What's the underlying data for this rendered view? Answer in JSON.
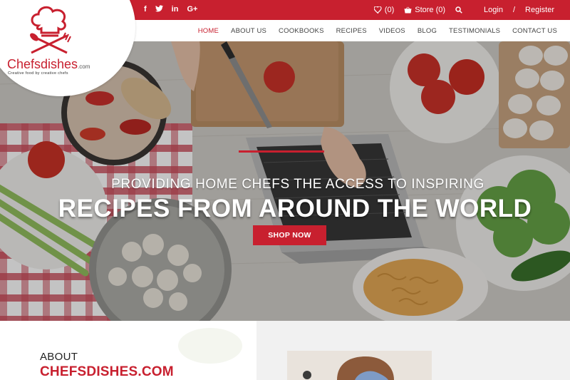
{
  "topbar": {
    "social": [
      {
        "icon": "facebook-icon",
        "glyph": "f"
      },
      {
        "icon": "twitter-icon",
        "glyph": "t"
      },
      {
        "icon": "linkedin-icon",
        "glyph": "in"
      },
      {
        "icon": "googleplus-icon",
        "glyph": "G+"
      }
    ],
    "wishlist_count": "(0)",
    "store_label": "Store (0)",
    "login": "Login",
    "separator": "/",
    "register": "Register"
  },
  "logo": {
    "name": "Chefsdishes",
    "suffix": ".com",
    "tagline": "Creative food by creative chefs"
  },
  "nav": {
    "items": [
      {
        "label": "HOME",
        "active": true
      },
      {
        "label": "ABOUT US",
        "active": false
      },
      {
        "label": "COOKBOOKS",
        "active": false
      },
      {
        "label": "RECIPES",
        "active": false
      },
      {
        "label": "VIDEOS",
        "active": false
      },
      {
        "label": "BLOG",
        "active": false
      },
      {
        "label": "TESTIMONIALS",
        "active": false
      },
      {
        "label": "CONTACT US",
        "active": false
      }
    ]
  },
  "hero": {
    "subtitle": "PROVIDING HOME CHEFS THE ACCESS TO INSPIRING",
    "title": "RECIPES FROM AROUND THE WORLD",
    "cta": "SHOP NOW"
  },
  "about": {
    "label": "ABOUT",
    "title": "CHEFSDISHES.COM"
  },
  "colors": {
    "brand_red": "#c8202f",
    "white": "#ffffff",
    "nav_text": "#444444"
  }
}
